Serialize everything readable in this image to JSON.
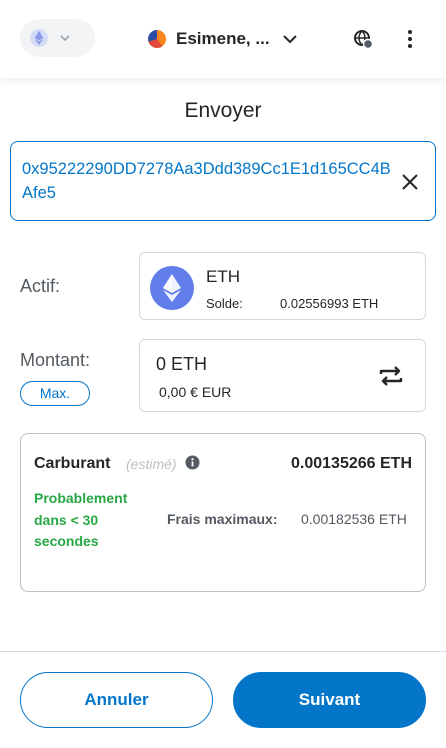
{
  "header": {
    "account_name": "Esimene, ...",
    "icons": [
      "ethereum-network-icon",
      "chevron-down-icon",
      "account-avatar",
      "globe-connected-icon",
      "kebab-menu-icon"
    ]
  },
  "page": {
    "title": "Envoyer"
  },
  "recipient": {
    "address": "0x95222290DD7278Aa3Ddd389Cc1E1d165CC4BAfe5"
  },
  "asset": {
    "label": "Actif:",
    "symbol": "ETH",
    "balance_label": "Solde:",
    "balance_value": "0.02556993 ETH"
  },
  "amount": {
    "label": "Montant:",
    "max_label": "Max.",
    "value": "0 ETH",
    "fiat_value": "0,00 € EUR"
  },
  "gas": {
    "title": "Carburant",
    "estimated_label": "(estimé)",
    "amount": "0.00135266 ETH",
    "time_estimate": "Probablement dans < 30 secondes",
    "max_fee_label": "Frais maximaux:",
    "max_fee_value": "0.00182536 ETH"
  },
  "footer": {
    "cancel_label": "Annuler",
    "next_label": "Suivant"
  },
  "colors": {
    "primary": "#0376c9",
    "success": "#28a745",
    "border": "#d6d9dc",
    "text": "#24272a"
  }
}
